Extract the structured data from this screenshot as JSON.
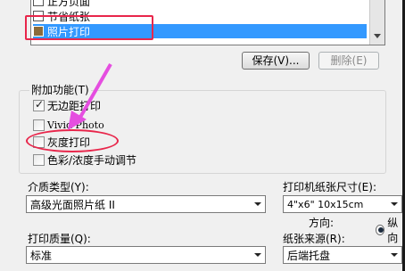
{
  "paper_list": {
    "items": [
      {
        "label": "正方页面",
        "selected": false
      },
      {
        "label": "节省纸张",
        "selected": false
      },
      {
        "label": "照片打印",
        "selected": true
      }
    ]
  },
  "buttons": {
    "save": "保存(V)...",
    "delete": "删除(E)"
  },
  "extra_features": {
    "title": "附加功能(T)",
    "options": [
      {
        "label": "无边距打印",
        "checked": true
      },
      {
        "label": "Vivid Photo",
        "checked": false
      },
      {
        "label": "灰度打印",
        "checked": false
      },
      {
        "label": "色彩/浓度手动调节",
        "checked": false
      }
    ]
  },
  "media_type": {
    "label": "介质类型(Y):",
    "value": "高级光面照片纸 II"
  },
  "paper_size": {
    "label": "打印机纸张尺寸(E):",
    "value": "4\"x6\" 10x15cm"
  },
  "orientation": {
    "label": "方向:",
    "option": "纵向"
  },
  "print_quality": {
    "label": "打印质量(Q):",
    "value": "标准"
  },
  "paper_source": {
    "label": "纸张来源(R):",
    "value": "后端托盘"
  },
  "colors": {
    "annotation": "#e8264b",
    "arrow": "#e54ee0",
    "selection": "#3399ff"
  }
}
